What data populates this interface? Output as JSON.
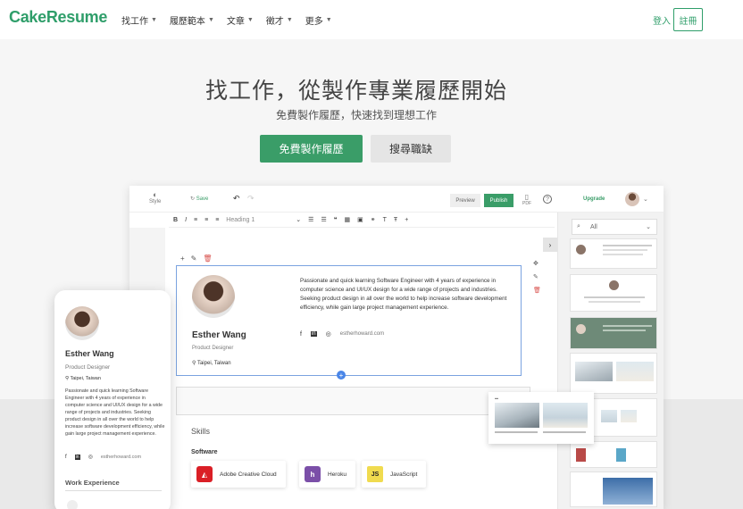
{
  "nav": {
    "logo": "CakeResume",
    "menu": [
      {
        "label": "找工作"
      },
      {
        "label": "履歷範本"
      },
      {
        "label": "文章"
      },
      {
        "label": "徵才"
      },
      {
        "label": "更多"
      }
    ],
    "login": "登入",
    "signup": "註冊"
  },
  "hero": {
    "title": "找工作，從製作專業履歷開始",
    "subtitle": "免費製作履歷，快速找到理想工作",
    "primary_button": "免費製作履歷",
    "secondary_button": "搜尋職缺"
  },
  "editor": {
    "style_label": "Style",
    "save_label": "Save",
    "preview_label": "Preview",
    "publish_label": "Publish",
    "pdf_label": "PDF",
    "upgrade_label": "Upgrade",
    "heading_select": "Heading 1",
    "template_filter": "All",
    "profile": {
      "name": "Esther Wang",
      "title": "Product Designer",
      "location": "Taipei, Taiwan",
      "bio": "Passionate and quick learning Software Engineer with 4 years of experience in computer science and UI/UX design for a wide range of projects and industries. Seeking product design in all over the world to help increase software development efficiency, while gain large project management experience.",
      "website": "estherhoward.com"
    },
    "skills_heading": "Skills",
    "software_heading": "Software",
    "software": [
      {
        "name": "Adobe Creative Cloud",
        "icon": "adobe-icon",
        "color": "#da1f26"
      },
      {
        "name": "Heroku",
        "icon": "heroku-icon",
        "color": "#7b4fa8"
      },
      {
        "name": "JavaScript",
        "icon": "javascript-icon",
        "color": "#f0db4f"
      }
    ]
  },
  "mobile": {
    "name": "Esther Wang",
    "title": "Product Designer",
    "location": "Taipei, Taiwan",
    "bio": "Passionate and quick learning Software Engineer with 4 years of experience in computer science and UI/UX design for a wide range of projects and industries. Seeking product design in all over the world to help increase software development efficiency, while gain large project management experience.",
    "website": "estherhoward.com",
    "work_heading": "Work Experience"
  },
  "colors": {
    "brand": "#2f9e6a",
    "primary_button": "#3a9d68",
    "selection": "#4a86e8"
  }
}
